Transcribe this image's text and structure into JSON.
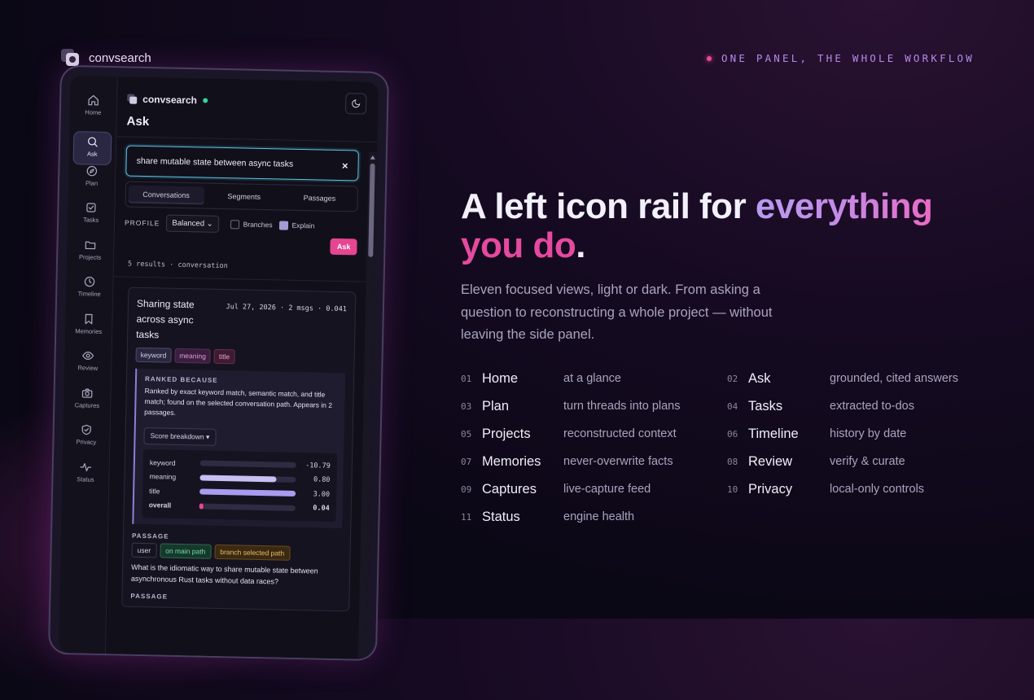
{
  "brand": {
    "name": "convsearch"
  },
  "tagline": "ONE PANEL, THE WHOLE WORKFLOW",
  "rail": [
    {
      "label": "Home",
      "icon": "home-icon"
    },
    {
      "label": "Ask",
      "icon": "search-icon",
      "active": true
    },
    {
      "label": "Plan",
      "icon": "compass-icon"
    },
    {
      "label": "Tasks",
      "icon": "checkbox-icon"
    },
    {
      "label": "Projects",
      "icon": "folder-icon"
    },
    {
      "label": "Timeline",
      "icon": "clock-icon"
    },
    {
      "label": "Memories",
      "icon": "bookmark-icon"
    },
    {
      "label": "Review",
      "icon": "eye-icon"
    },
    {
      "label": "Captures",
      "icon": "camera-icon"
    },
    {
      "label": "Privacy",
      "icon": "shield-check-icon"
    },
    {
      "label": "Status",
      "icon": "pulse-icon"
    }
  ],
  "panel": {
    "app_name": "convsearch",
    "title": "Ask",
    "search": {
      "value": "share mutable state between async tasks",
      "clear": "×"
    },
    "tabs": [
      "Conversations",
      "Segments",
      "Passages"
    ],
    "profile_label": "PROFILE",
    "profile_value": "Balanced",
    "branches_label": "Branches",
    "explain_label": "Explain",
    "ask_label": "Ask",
    "results_text": "5 results · conversation",
    "card": {
      "title": "Sharing state across async tasks",
      "meta": "Jul 27, 2026 · 2 msgs · 0.041",
      "tags": [
        "keyword",
        "meaning",
        "title"
      ],
      "ranked_heading": "RANKED BECAUSE",
      "ranked_text": "Ranked by exact keyword match, semantic match, and title match; found on the selected conversation path. Appears in 2 passages.",
      "breakdown_label": "Score breakdown",
      "scores": [
        {
          "name": "keyword",
          "value": "-10.79",
          "fill": 0.0,
          "color": "#6b6780"
        },
        {
          "name": "meaning",
          "value": "0.80",
          "fill": 0.8,
          "color": "#c9bff2"
        },
        {
          "name": "title",
          "value": "3.00",
          "fill": 1.0,
          "color": "#a99cf0"
        },
        {
          "name": "overall",
          "value": "0.04",
          "fill": 0.04,
          "color": "#e64591"
        }
      ],
      "passage_heading": "PASSAGE",
      "passage_tags": [
        "user",
        "on main path",
        "branch selected path"
      ],
      "passage_text": "What is the idiomatic way to share mutable state between asynchronous Rust tasks without data races?",
      "passage2_heading": "PASSAGE"
    }
  },
  "hero": {
    "line1a": "A left icon rail for ",
    "line1b": "everything",
    "line2a": "you do",
    "line2b": "."
  },
  "subtitle": "Eleven focused views, light or dark. From asking a question to reconstructing a whole project — without leaving the side panel.",
  "views": [
    {
      "num": "01",
      "name": "Home",
      "desc": "at a glance"
    },
    {
      "num": "02",
      "name": "Ask",
      "desc": "grounded, cited answers"
    },
    {
      "num": "03",
      "name": "Plan",
      "desc": "turn threads into plans"
    },
    {
      "num": "04",
      "name": "Tasks",
      "desc": "extracted to-dos"
    },
    {
      "num": "05",
      "name": "Projects",
      "desc": "reconstructed context"
    },
    {
      "num": "06",
      "name": "Timeline",
      "desc": "history by date"
    },
    {
      "num": "07",
      "name": "Memories",
      "desc": "never-overwrite facts"
    },
    {
      "num": "08",
      "name": "Review",
      "desc": "verify & curate"
    },
    {
      "num": "09",
      "name": "Captures",
      "desc": "live-capture feed"
    },
    {
      "num": "10",
      "name": "Privacy",
      "desc": "local-only controls"
    },
    {
      "num": "11",
      "name": "Status",
      "desc": "engine health"
    }
  ]
}
